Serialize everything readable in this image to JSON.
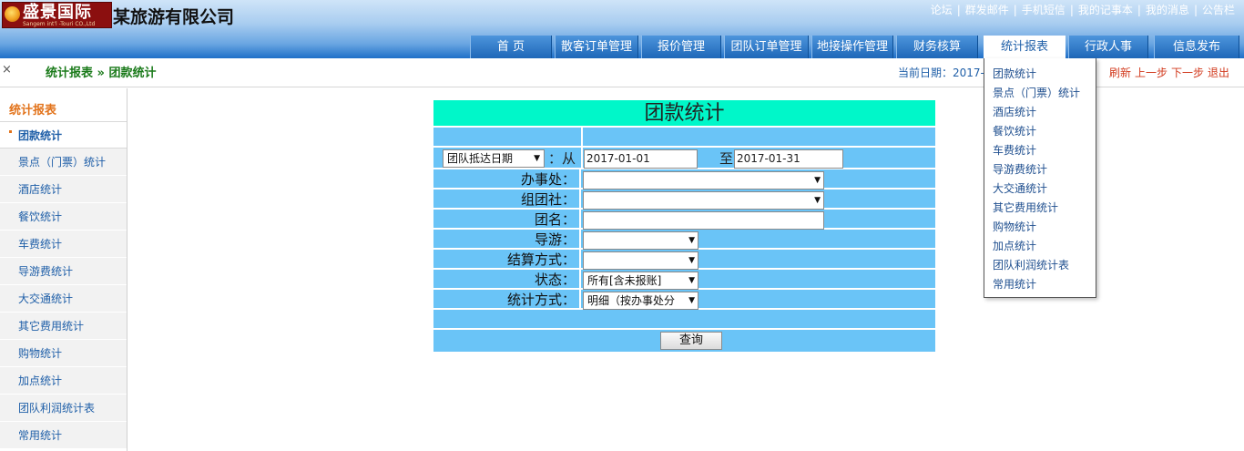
{
  "header": {
    "logo_cn": "盛景国际",
    "logo_en": "Sangem int'l -Touri CO.,Ltd",
    "company_name": "某旅游有限公司",
    "top_links": [
      "论坛",
      "群发邮件",
      "手机短信",
      "我的记事本",
      "我的消息",
      "公告栏"
    ]
  },
  "nav": {
    "items": [
      "首 页",
      "散客订单管理",
      "报价管理",
      "团队订单管理",
      "地接操作管理",
      "财务核算",
      "统计报表",
      "行政人事",
      "信息发布"
    ],
    "active": "统计报表"
  },
  "breadcrumb": {
    "close": "×",
    "text": "统计报表 » 团款统计",
    "date_label": "当前日期：",
    "date_value": "2017-",
    "actions": [
      "刷新",
      "上一步",
      "下一步",
      "退出"
    ]
  },
  "sidebar": {
    "title": "统计报表",
    "items": [
      "团款统计",
      "景点（门票）统计",
      "酒店统计",
      "餐饮统计",
      "车费统计",
      "导游费统计",
      "大交通统计",
      "其它费用统计",
      "购物统计",
      "加点统计",
      "团队利润统计表",
      "常用统计"
    ],
    "active": "团款统计"
  },
  "dropdown": {
    "items": [
      "团款统计",
      "景点（门票）统计",
      "酒店统计",
      "餐饮统计",
      "车费统计",
      "导游费统计",
      "大交通统计",
      "其它费用统计",
      "购物统计",
      "加点统计",
      "团队利润统计表",
      "常用统计"
    ]
  },
  "form": {
    "title": "团款统计",
    "date_type": "团队抵达日期",
    "from_label": "：从",
    "date_from": "2017-01-01",
    "to_label": "至",
    "date_to": "2017-01-31",
    "office_label": "办事处：",
    "office_value": "",
    "agency_label": "组团社：",
    "agency_value": "",
    "group_name_label": "团名：",
    "group_name_value": "",
    "guide_label": "导游：",
    "guide_value": "",
    "settle_label": "结算方式：",
    "settle_value": "",
    "status_label": "状态：",
    "status_value": "所有[含未报账]",
    "stat_label": "统计方式：",
    "stat_value": "明细（按办事处分",
    "query_button": "查询"
  },
  "colors": {
    "title_bg": "#00f7c9",
    "row_bg": "#6ac4f7",
    "nav_bg": "#1e67b8",
    "sidebar_title": "#e2731b",
    "crumb_green": "#1a7a1a",
    "action_red": "#d23a1e"
  },
  "icons": {
    "dropdown_arrow": "triangle-down-icon",
    "close": "close-icon",
    "logo": "globe-emblem-icon"
  }
}
